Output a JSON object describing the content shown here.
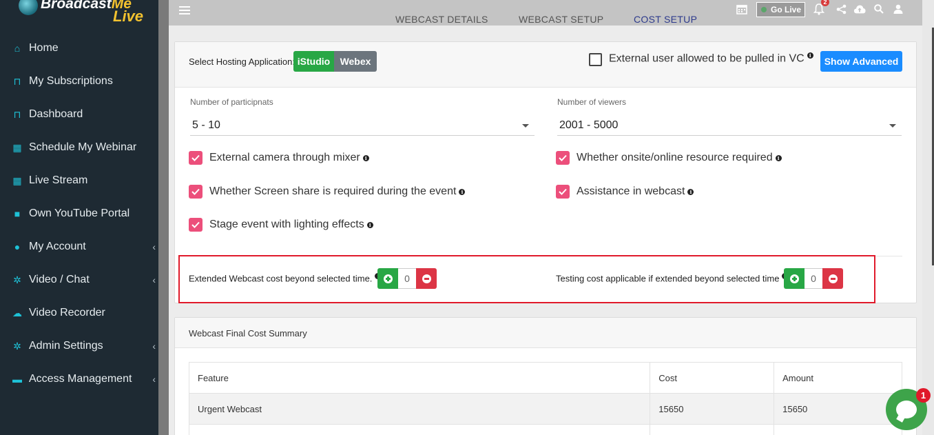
{
  "brand": {
    "name_part1": "Broadcast",
    "name_part2": "Me",
    "name_part3": "Live"
  },
  "sidebar": {
    "items": [
      {
        "label": "Home",
        "icon": "home-icon",
        "glyph": "⌂",
        "chevron": false
      },
      {
        "label": "My Subscriptions",
        "icon": "bookmark-icon",
        "glyph": "⊓",
        "chevron": false
      },
      {
        "label": "Dashboard",
        "icon": "bookmark-icon",
        "glyph": "⊓",
        "chevron": false
      },
      {
        "label": "Schedule My Webinar",
        "icon": "calendar-plus-icon",
        "glyph": "▦",
        "chevron": false
      },
      {
        "label": "Live Stream",
        "icon": "calendar-icon",
        "glyph": "▦",
        "chevron": false
      },
      {
        "label": "Own YouTube Portal",
        "icon": "video-camera-icon",
        "glyph": "■",
        "chevron": false
      },
      {
        "label": "My Account",
        "icon": "user-icon",
        "glyph": "●",
        "chevron": true
      },
      {
        "label": "Video / Chat",
        "icon": "cogs-icon",
        "glyph": "✲",
        "chevron": true
      },
      {
        "label": "Video Recorder",
        "icon": "cloud-upload-icon",
        "glyph": "☁",
        "chevron": false
      },
      {
        "label": "Admin Settings",
        "icon": "cogs-icon",
        "glyph": "✲",
        "chevron": true
      },
      {
        "label": "Access Management",
        "icon": "unlock-icon",
        "glyph": "▬",
        "chevron": true
      }
    ]
  },
  "header": {
    "tabs": [
      {
        "label": "WEBCAST DETAILS",
        "active": false
      },
      {
        "label": "WEBCAST SETUP",
        "active": false
      },
      {
        "label": "COST SETUP",
        "active": true
      }
    ],
    "go_live_label": "Go Live",
    "notification_count": "2"
  },
  "hosting": {
    "label": "Select Hosting Application:",
    "options": [
      "iStudio",
      "Webex"
    ],
    "selected": "iStudio",
    "external_user_label": "External user allowed to be pulled in VC",
    "external_user_checked": false,
    "show_advanced_label": "Show Advanced"
  },
  "form": {
    "participants_label": "Number of participnats",
    "participants_value": "5 - 10",
    "viewers_label": "Number of viewers",
    "viewers_value": "2001 - 5000",
    "checkboxes": [
      {
        "label": "External camera through mixer",
        "checked": true
      },
      {
        "label": "Whether onsite/online resource required",
        "checked": true
      },
      {
        "label": "Whether Screen share is required during the event",
        "checked": true
      },
      {
        "label": "Assistance in webcast",
        "checked": true
      },
      {
        "label": "Stage event with lighting effects",
        "checked": true
      }
    ]
  },
  "extended": {
    "webcast_label": "Extended Webcast cost beyond selected time.",
    "webcast_value": "0",
    "testing_label": "Testing cost applicable if extended beyond selected time",
    "testing_value": "0"
  },
  "summary": {
    "title": "Webcast Final Cost Summary",
    "columns": [
      "Feature",
      "Cost",
      "Amount"
    ],
    "rows": [
      [
        "Urgent Webcast",
        "15650",
        "15650"
      ]
    ]
  },
  "chat": {
    "badge": "1"
  },
  "colors": {
    "sidebar_bg": "#1e2a33",
    "accent_cyan": "#1ec1d6",
    "checkbox_pink": "#ec4f7b",
    "success": "#28a745",
    "danger": "#dc3545",
    "primary": "#1a8cff"
  }
}
